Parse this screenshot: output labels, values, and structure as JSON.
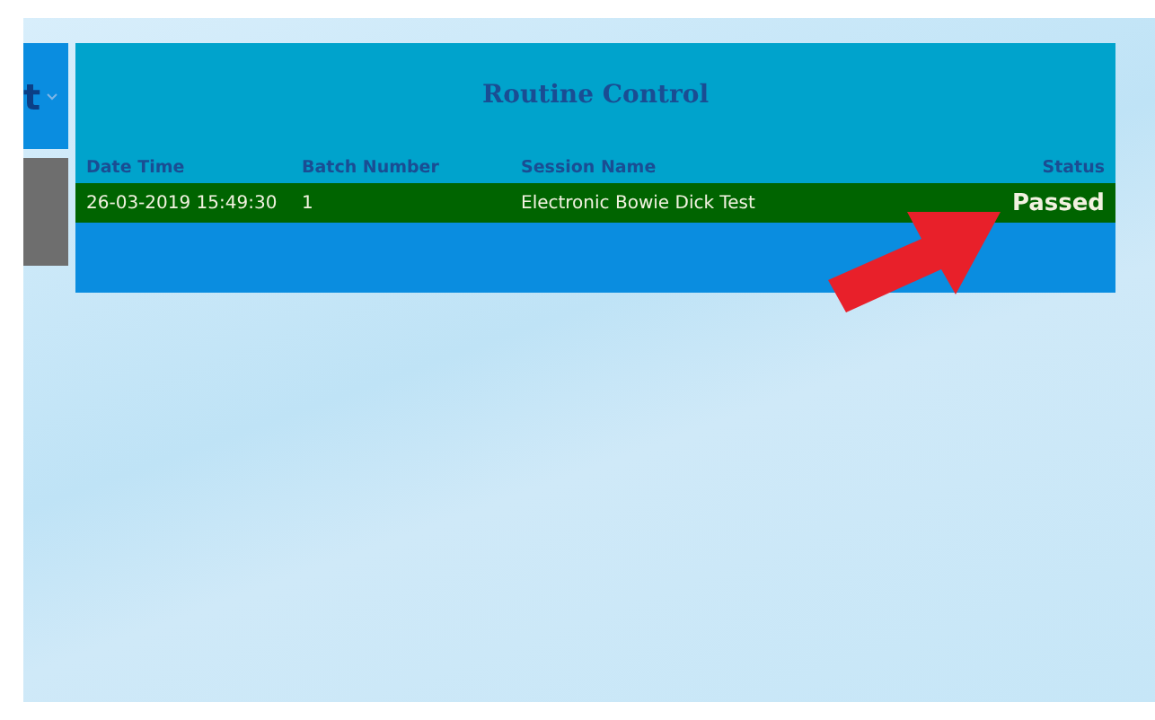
{
  "side_button": {
    "label": "t"
  },
  "panel": {
    "title": "Routine Control",
    "columns": [
      "Date Time",
      "Batch Number",
      "Session Name",
      "Status"
    ],
    "rows": [
      {
        "cells": [
          "26-03-2019 15:49:30",
          "1",
          "Electronic Bowie Dick Test",
          "Passed"
        ]
      }
    ]
  }
}
